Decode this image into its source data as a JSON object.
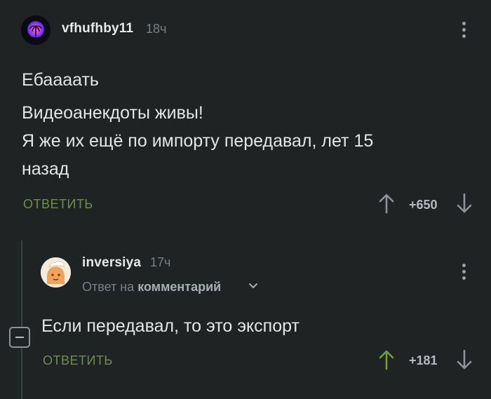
{
  "comment": {
    "username": "vfhufhby11",
    "time": "18ч",
    "lines": [
      "Ебаааать",
      "Видеоанекдоты живы!",
      "Я же их ещё по импорту передавал, лет 15",
      "назад"
    ],
    "reply_label": "ОТВЕТИТЬ",
    "rating": "+650"
  },
  "reply": {
    "username": "inversiya",
    "time": "17ч",
    "reply_to_prefix": "Ответ на",
    "reply_to_link": "комментарий",
    "text": "Если передавал, то это экспорт",
    "reply_label": "ОТВЕТИТЬ",
    "rating": "+181"
  },
  "colors": {
    "background": "#1f2324",
    "accent_green": "#6f8d4f",
    "upvoted_arrow": "#6f9e3c"
  }
}
